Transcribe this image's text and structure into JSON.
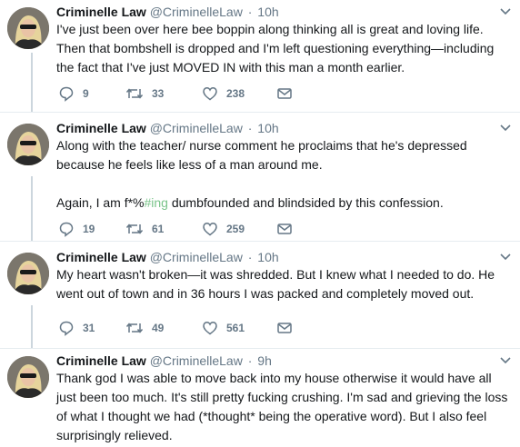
{
  "tweets": [
    {
      "name": "Criminelle Law",
      "handle": "@CriminelleLaw",
      "time": "10h",
      "text": "I've just been over here bee boppin along thinking all is great and loving life.\nThen that bombshell is dropped and I'm left questioning everything—including\nthe fact that I've just MOVED IN with this man a month earlier.",
      "replies": "9",
      "retweets": "33",
      "likes": "238"
    },
    {
      "name": "Criminelle Law",
      "handle": "@CriminelleLaw",
      "time": "10h",
      "text_before": "Along with the teacher/ nurse comment he proclaims that he's depressed\nbecause he feels like less of a man around me.\n\nAgain, I am f*%",
      "hashtag": "#ing",
      "text_after": " dumbfounded and blindsided by this confession.",
      "replies": "19",
      "retweets": "61",
      "likes": "259"
    },
    {
      "name": "Criminelle Law",
      "handle": "@CriminelleLaw",
      "time": "10h",
      "text": "My heart wasn't broken—it was shredded. But I knew what I needed to do. He\nwent out of town and in 36 hours I was packed and completely moved out.",
      "replies": "31",
      "retweets": "49",
      "likes": "561"
    },
    {
      "name": "Criminelle Law",
      "handle": "@CriminelleLaw",
      "time": "9h",
      "text": "Thank god I was able to move back into my house otherwise it would have all\njust been too much. It's still pretty fucking crushing. I'm sad and grieving the loss\nof what I thought we had (*thought* being the operative word). But I also feel\nsurprisingly relieved."
    }
  ],
  "separator": "·",
  "colors": {
    "hashtag": "#7ac48a",
    "muted": "#657786",
    "thread_line": "#ccd6dd"
  }
}
